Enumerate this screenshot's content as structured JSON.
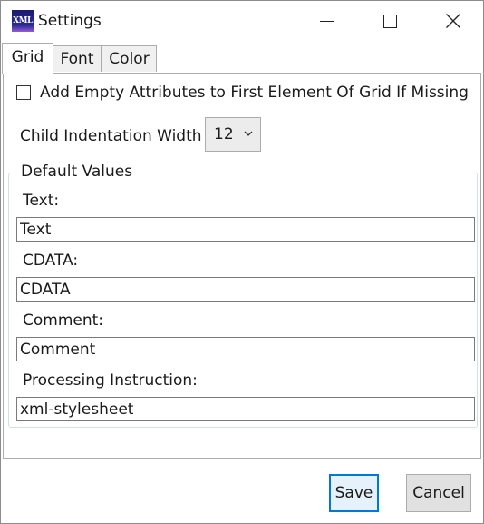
{
  "window": {
    "title": "Settings",
    "icon_label": "XML"
  },
  "tabs": [
    {
      "label": "Grid",
      "active": true
    },
    {
      "label": "Font",
      "active": false
    },
    {
      "label": "Color",
      "active": false
    }
  ],
  "grid": {
    "checkbox_label": "Add Empty Attributes to First Element Of Grid If Missing",
    "checkbox_checked": false,
    "indent_label": "Child Indentation Width",
    "indent_value": "12"
  },
  "defaults": {
    "group_title": "Default Values",
    "text_label": "Text:",
    "text_value": "Text",
    "cdata_label": "CDATA:",
    "cdata_value": "CDATA",
    "comment_label": "Comment:",
    "comment_value": "Comment",
    "pi_label": "Processing Instruction:",
    "pi_value": "xml-stylesheet"
  },
  "buttons": {
    "save": "Save",
    "cancel": "Cancel"
  },
  "colors": {
    "accent": "#0078d7"
  }
}
